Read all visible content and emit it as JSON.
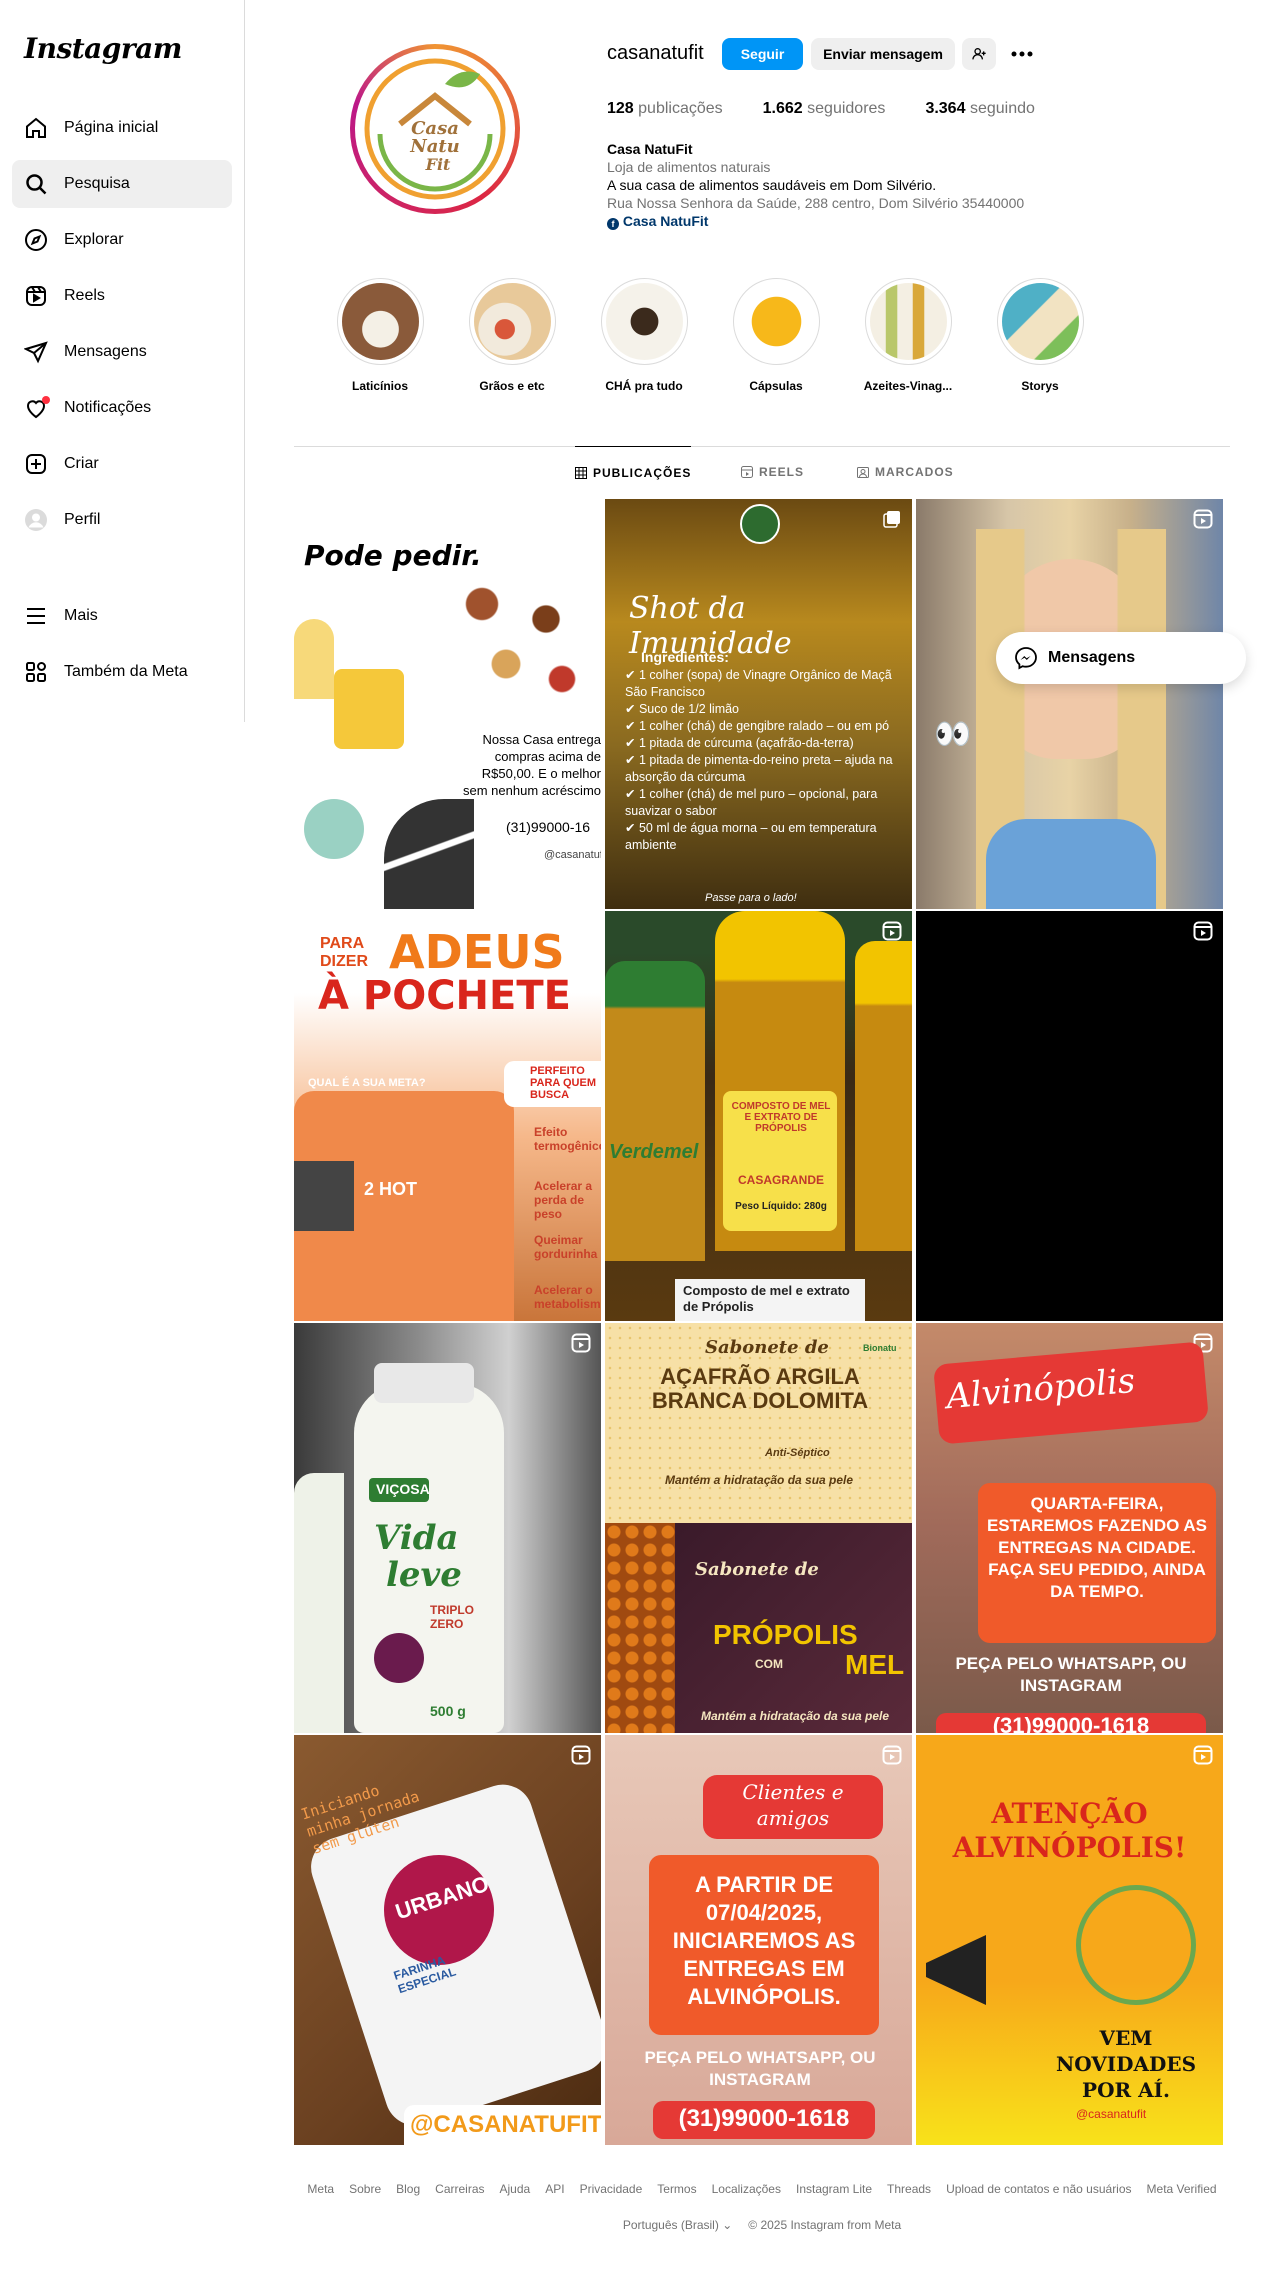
{
  "sidebar": {
    "logo": "Instagram",
    "items": [
      {
        "label": "Página inicial",
        "icon": "home-icon"
      },
      {
        "label": "Pesquisa",
        "icon": "search-icon"
      },
      {
        "label": "Explorar",
        "icon": "compass-icon"
      },
      {
        "label": "Reels",
        "icon": "reels-icon"
      },
      {
        "label": "Mensagens",
        "icon": "send-icon"
      },
      {
        "label": "Notificações",
        "icon": "heart-icon"
      },
      {
        "label": "Criar",
        "icon": "plus-square-icon"
      },
      {
        "label": "Perfil",
        "icon": "avatar-icon"
      },
      {
        "label": "Mais",
        "icon": "menu-icon"
      },
      {
        "label": "Também da Meta",
        "icon": "meta-apps-icon"
      }
    ]
  },
  "profile": {
    "username": "casanatufit",
    "follow_label": "Seguir",
    "message_label": "Enviar mensagem",
    "posts_count": "128",
    "posts_label": "publicações",
    "followers_count": "1.662",
    "followers_label": "seguidores",
    "following_count": "3.364",
    "following_label": "seguindo",
    "display_name": "Casa NatuFit",
    "category": "Loja de alimentos naturais",
    "bio_line": "A sua casa de alimentos saudáveis em Dom Silvério.",
    "address": "Rua Nossa Senhora da Saúde, 288 centro, Dom Silvério 35440000",
    "link_label": "Casa NatuFit",
    "avatar_text": [
      "Casa",
      "Natu",
      "Fit"
    ]
  },
  "highlights": [
    "Laticínios",
    "Grãos e etc",
    "CHÁ pra tudo",
    "Cápsulas",
    "Azeites-Vinag...",
    "Storys"
  ],
  "tabs": [
    "PUBLICAÇÕES",
    "REELS",
    "MARCADOS"
  ],
  "posts": {
    "p1": {
      "title": "Pode pedir.",
      "body": "Nossa Casa entrega compras acima de R$50,00. E o melhor sem nenhum acréscimo",
      "phone": "(31)99000-16",
      "handle": "@casanatufit"
    },
    "p2": {
      "title": "Shot da Imunidade",
      "heading": "Ingredientes:",
      "lines": [
        "1 colher (sopa) de Vinagre Orgânico de Maçã São Francisco",
        "Suco de 1/2 limão",
        "1 colher (chá) de gengibre ralado – ou em pó",
        "1 pitada de cúrcuma (açafrão-da-terra)",
        "1 pitada de pimenta-do-reino preta – ajuda na absorção da cúrcuma",
        "1 colher (chá) de mel puro – opcional, para suavizar o sabor",
        "50 ml de água morna – ou em temperatura ambiente"
      ],
      "footer": "Passe para o lado!"
    },
    "p4": {
      "line1": "PARA DIZER",
      "line2": "ADEUS",
      "line3": "À POCHETE",
      "question": "QUAL É A SUA META?",
      "badge": "PERFEITO PARA QUEM BUSCA",
      "items": [
        "Efeito termogênico",
        "Acelerar a perda de peso",
        "Queimar gordurinha",
        "Acelerar o metabolismo"
      ],
      "product": "2 HOT"
    },
    "p5": {
      "label1": "COMPOSTO DE MEL E EXTRATO DE PRÓPOLIS",
      "brand": "CASAGRANDE",
      "weight": "Peso Líquido: 280g",
      "tag": "Composto de mel e extrato de Própolis",
      "side": "Verdemel"
    },
    "p7": {
      "brand": "VIÇOSA",
      "name1": "Vida",
      "name2": "leve",
      "sub": "TRIPLO ZERO",
      "qty": "500 g"
    },
    "p8": {
      "top_title": "Sabonete de",
      "top_main": "AÇAFRÃO ARGILA BRANCA DOLOMITA",
      "top_sub": "Anti-Séptico",
      "top_foot": "Mantém a hidratação da sua pele",
      "bot_title": "Sabonete de",
      "bot_main": "PRÓPOLIS",
      "bot_com": "COM",
      "bot_mel": "MEL",
      "bot_foot": "Mantém a hidratação da sua pele",
      "brand": "Bionatu"
    },
    "p9": {
      "city": "Alvinópolis",
      "box": "QUARTA-FEIRA, ESTAREMOS FAZENDO AS ENTREGAS NA CIDADE. FAÇA SEU PEDIDO, AINDA DA TEMPO.",
      "cta": "PEÇA PELO WHATSAPP, OU INSTAGRAM",
      "phone": "(31)99000-1618"
    },
    "p10": {
      "caption": "Iniciando minha jornada sem glúten",
      "brand": "URBANO",
      "product": "FARINHA ESPECIAL",
      "handle": "@CASANATUFIT"
    },
    "p11": {
      "bubble": "Clientes e amigos",
      "box": "A PARTIR DE 07/04/2025, INICIAREMOS AS ENTREGAS EM ALVINÓPOLIS.",
      "cta": "PEÇA PELO WHATSAPP, OU INSTAGRAM",
      "phone": "(31)99000-1618"
    },
    "p12": {
      "title": "ATENÇÃO ALVINÓPOLIS!",
      "body": "VEM NOVIDADES POR AÍ.",
      "handle": "@casanatufit"
    }
  },
  "floating": {
    "label": "Mensagens"
  },
  "footer": {
    "links": [
      "Meta",
      "Sobre",
      "Blog",
      "Carreiras",
      "Ajuda",
      "API",
      "Privacidade",
      "Termos",
      "Localizações",
      "Instagram Lite",
      "Threads",
      "Upload de contatos e não usuários",
      "Meta Verified"
    ],
    "language": "Português (Brasil)",
    "copyright": "© 2025 Instagram from Meta"
  },
  "colors": {
    "accent": "#0095f6",
    "link": "#00376b",
    "muted": "#737373",
    "border": "#dbdbdb"
  }
}
